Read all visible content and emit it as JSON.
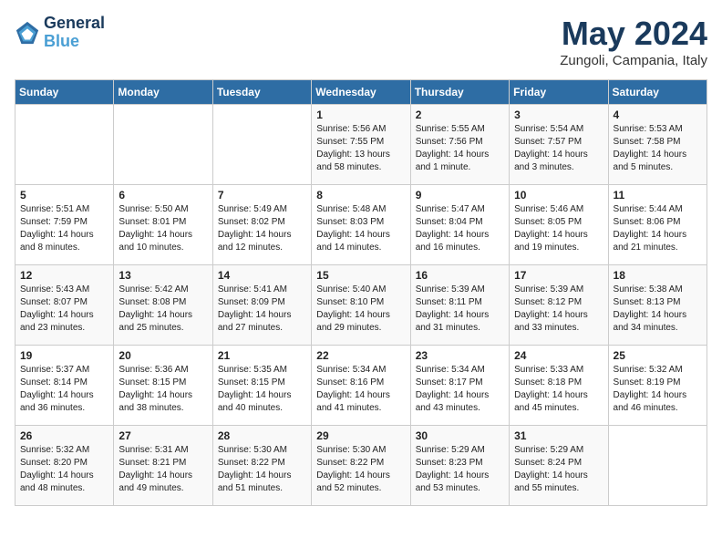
{
  "header": {
    "logo_line1": "General",
    "logo_line2": "Blue",
    "month": "May 2024",
    "location": "Zungoli, Campania, Italy"
  },
  "days_of_week": [
    "Sunday",
    "Monday",
    "Tuesday",
    "Wednesday",
    "Thursday",
    "Friday",
    "Saturday"
  ],
  "weeks": [
    [
      {
        "day": "",
        "content": ""
      },
      {
        "day": "",
        "content": ""
      },
      {
        "day": "",
        "content": ""
      },
      {
        "day": "1",
        "content": "Sunrise: 5:56 AM\nSunset: 7:55 PM\nDaylight: 13 hours\nand 58 minutes."
      },
      {
        "day": "2",
        "content": "Sunrise: 5:55 AM\nSunset: 7:56 PM\nDaylight: 14 hours\nand 1 minute."
      },
      {
        "day": "3",
        "content": "Sunrise: 5:54 AM\nSunset: 7:57 PM\nDaylight: 14 hours\nand 3 minutes."
      },
      {
        "day": "4",
        "content": "Sunrise: 5:53 AM\nSunset: 7:58 PM\nDaylight: 14 hours\nand 5 minutes."
      }
    ],
    [
      {
        "day": "5",
        "content": "Sunrise: 5:51 AM\nSunset: 7:59 PM\nDaylight: 14 hours\nand 8 minutes."
      },
      {
        "day": "6",
        "content": "Sunrise: 5:50 AM\nSunset: 8:01 PM\nDaylight: 14 hours\nand 10 minutes."
      },
      {
        "day": "7",
        "content": "Sunrise: 5:49 AM\nSunset: 8:02 PM\nDaylight: 14 hours\nand 12 minutes."
      },
      {
        "day": "8",
        "content": "Sunrise: 5:48 AM\nSunset: 8:03 PM\nDaylight: 14 hours\nand 14 minutes."
      },
      {
        "day": "9",
        "content": "Sunrise: 5:47 AM\nSunset: 8:04 PM\nDaylight: 14 hours\nand 16 minutes."
      },
      {
        "day": "10",
        "content": "Sunrise: 5:46 AM\nSunset: 8:05 PM\nDaylight: 14 hours\nand 19 minutes."
      },
      {
        "day": "11",
        "content": "Sunrise: 5:44 AM\nSunset: 8:06 PM\nDaylight: 14 hours\nand 21 minutes."
      }
    ],
    [
      {
        "day": "12",
        "content": "Sunrise: 5:43 AM\nSunset: 8:07 PM\nDaylight: 14 hours\nand 23 minutes."
      },
      {
        "day": "13",
        "content": "Sunrise: 5:42 AM\nSunset: 8:08 PM\nDaylight: 14 hours\nand 25 minutes."
      },
      {
        "day": "14",
        "content": "Sunrise: 5:41 AM\nSunset: 8:09 PM\nDaylight: 14 hours\nand 27 minutes."
      },
      {
        "day": "15",
        "content": "Sunrise: 5:40 AM\nSunset: 8:10 PM\nDaylight: 14 hours\nand 29 minutes."
      },
      {
        "day": "16",
        "content": "Sunrise: 5:39 AM\nSunset: 8:11 PM\nDaylight: 14 hours\nand 31 minutes."
      },
      {
        "day": "17",
        "content": "Sunrise: 5:39 AM\nSunset: 8:12 PM\nDaylight: 14 hours\nand 33 minutes."
      },
      {
        "day": "18",
        "content": "Sunrise: 5:38 AM\nSunset: 8:13 PM\nDaylight: 14 hours\nand 34 minutes."
      }
    ],
    [
      {
        "day": "19",
        "content": "Sunrise: 5:37 AM\nSunset: 8:14 PM\nDaylight: 14 hours\nand 36 minutes."
      },
      {
        "day": "20",
        "content": "Sunrise: 5:36 AM\nSunset: 8:15 PM\nDaylight: 14 hours\nand 38 minutes."
      },
      {
        "day": "21",
        "content": "Sunrise: 5:35 AM\nSunset: 8:15 PM\nDaylight: 14 hours\nand 40 minutes."
      },
      {
        "day": "22",
        "content": "Sunrise: 5:34 AM\nSunset: 8:16 PM\nDaylight: 14 hours\nand 41 minutes."
      },
      {
        "day": "23",
        "content": "Sunrise: 5:34 AM\nSunset: 8:17 PM\nDaylight: 14 hours\nand 43 minutes."
      },
      {
        "day": "24",
        "content": "Sunrise: 5:33 AM\nSunset: 8:18 PM\nDaylight: 14 hours\nand 45 minutes."
      },
      {
        "day": "25",
        "content": "Sunrise: 5:32 AM\nSunset: 8:19 PM\nDaylight: 14 hours\nand 46 minutes."
      }
    ],
    [
      {
        "day": "26",
        "content": "Sunrise: 5:32 AM\nSunset: 8:20 PM\nDaylight: 14 hours\nand 48 minutes."
      },
      {
        "day": "27",
        "content": "Sunrise: 5:31 AM\nSunset: 8:21 PM\nDaylight: 14 hours\nand 49 minutes."
      },
      {
        "day": "28",
        "content": "Sunrise: 5:30 AM\nSunset: 8:22 PM\nDaylight: 14 hours\nand 51 minutes."
      },
      {
        "day": "29",
        "content": "Sunrise: 5:30 AM\nSunset: 8:22 PM\nDaylight: 14 hours\nand 52 minutes."
      },
      {
        "day": "30",
        "content": "Sunrise: 5:29 AM\nSunset: 8:23 PM\nDaylight: 14 hours\nand 53 minutes."
      },
      {
        "day": "31",
        "content": "Sunrise: 5:29 AM\nSunset: 8:24 PM\nDaylight: 14 hours\nand 55 minutes."
      },
      {
        "day": "",
        "content": ""
      }
    ]
  ]
}
